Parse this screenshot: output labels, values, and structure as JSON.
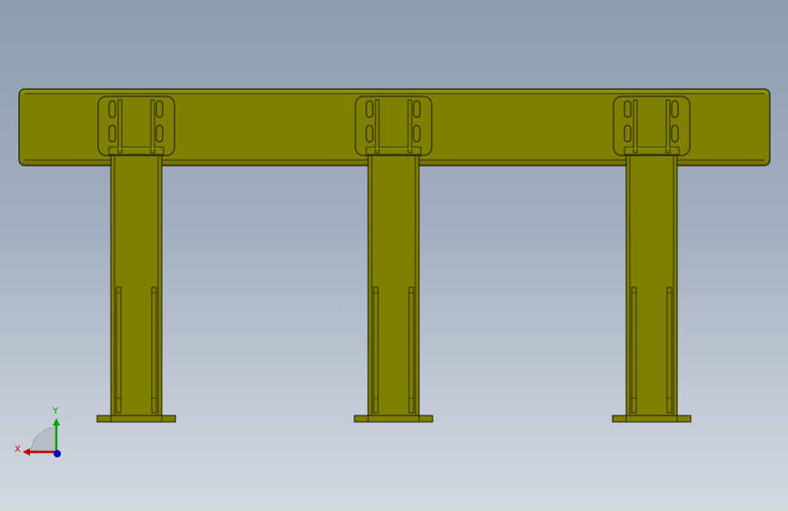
{
  "viewport": {
    "background_top": "#8e9db2",
    "background_bottom": "#d4d8df"
  },
  "model": {
    "body_color": "#808000",
    "edge_color": "#1a1a00",
    "highlight_color": "#c8c800",
    "post_count": 3
  },
  "triad": {
    "x_label": "X",
    "y_label": "Y",
    "x_color": "#c00000",
    "y_color": "#00a000",
    "z_color": "#0000c0"
  }
}
